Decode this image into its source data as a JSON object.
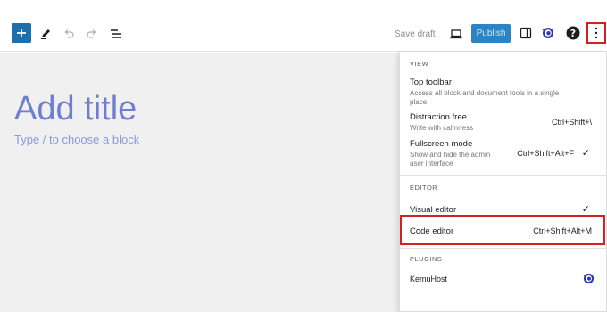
{
  "toolbar": {
    "save_draft": "Save draft",
    "publish": "Publish"
  },
  "editor": {
    "title_placeholder": "Add title",
    "block_placeholder": "Type / to choose a block"
  },
  "menu": {
    "view_heading": "VIEW",
    "top_toolbar": {
      "label": "Top toolbar",
      "desc": "Access all block and document tools in a single place"
    },
    "distraction_free": {
      "label": "Distraction free",
      "desc": "Write with calmness",
      "shortcut": "Ctrl+Shift+\\"
    },
    "fullscreen": {
      "label": "Fullscreen mode",
      "desc": "Show and hide the admin user interface",
      "shortcut": "Ctrl+Shift+Alt+F",
      "check": "✓"
    },
    "editor_heading": "EDITOR",
    "visual_editor": {
      "label": "Visual editor",
      "check": "✓"
    },
    "code_editor": {
      "label": "Code editor",
      "shortcut": "Ctrl+Shift+Alt+M"
    },
    "plugins_heading": "PLUGINS",
    "kemuhost": {
      "label": "KemuHost"
    }
  },
  "colors": {
    "accent": "#2b84c4",
    "highlight": "#d62020",
    "placeholder": "#6f7ed0"
  }
}
